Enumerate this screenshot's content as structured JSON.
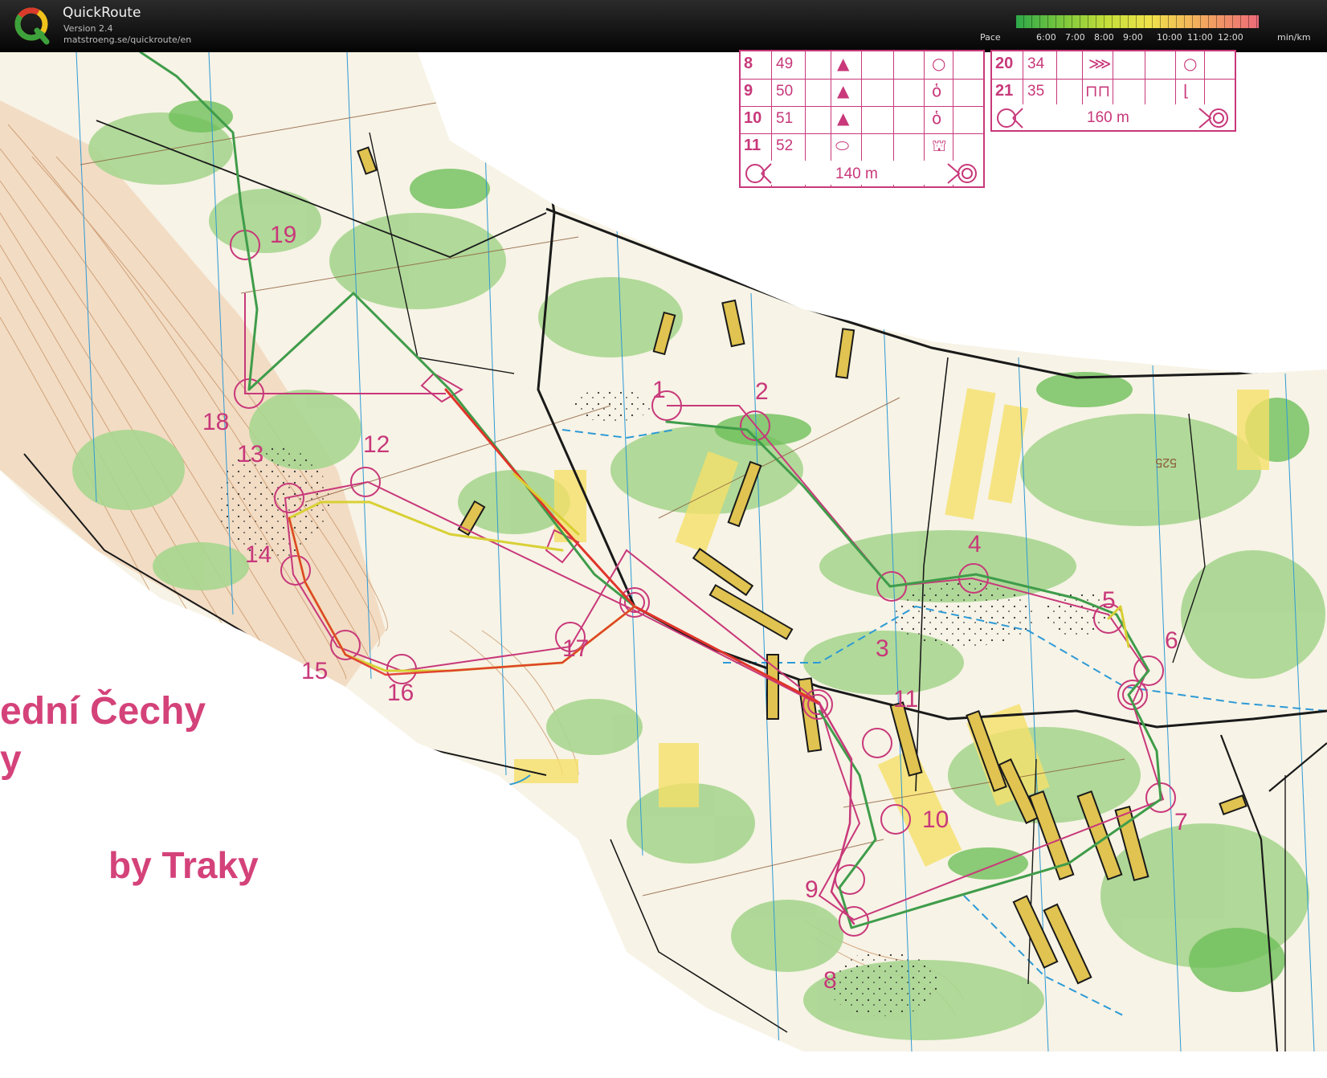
{
  "app": {
    "title": "QuickRoute",
    "version": "Version 2.4",
    "url": "matstroeng.se/quickroute/en"
  },
  "pace": {
    "label": "Pace",
    "ticks": [
      "6:00",
      "7:00",
      "8:00",
      "9:00",
      "10:00",
      "11:00",
      "12:00"
    ],
    "unit": "min/km"
  },
  "colors": {
    "course": "#c8387a",
    "route_red": "#e0342a",
    "route_green": "#3f9c4a",
    "route_yellow": "#d8d034",
    "forest_green": "#9fd28a",
    "open_yellow": "#f5e06a",
    "water_blue": "#2d9ad6"
  },
  "control_table_left": {
    "rows": [
      {
        "num": "8",
        "code": "49",
        "feature": "▲",
        "appearance": "○"
      },
      {
        "num": "9",
        "code": "50",
        "feature": "▲",
        "appearance": "ὁ"
      },
      {
        "num": "10",
        "code": "51",
        "feature": "▲",
        "appearance": "ὁ"
      },
      {
        "num": "11",
        "code": "52",
        "feature": "⬭",
        "appearance": "⛫"
      }
    ],
    "finish_distance": "140 m"
  },
  "control_table_right": {
    "rows": [
      {
        "num": "20",
        "code": "34",
        "feature": "⋙",
        "appearance": "○"
      },
      {
        "num": "21",
        "code": "35",
        "feature": "⊓⊓",
        "appearance": "⌊"
      }
    ],
    "finish_distance": "160 m"
  },
  "controls": [
    {
      "label": "1"
    },
    {
      "label": "2"
    },
    {
      "label": "3"
    },
    {
      "label": "4"
    },
    {
      "label": "5"
    },
    {
      "label": "6"
    },
    {
      "label": "7"
    },
    {
      "label": "8"
    },
    {
      "label": "9"
    },
    {
      "label": "10"
    },
    {
      "label": "11"
    },
    {
      "label": "12"
    },
    {
      "label": "13"
    },
    {
      "label": "14"
    },
    {
      "label": "15"
    },
    {
      "label": "16"
    },
    {
      "label": "17"
    },
    {
      "label": "18"
    },
    {
      "label": "19"
    }
  ],
  "map_texts": {
    "region_line1": "ední Čechy",
    "region_line2": "y",
    "author": "by Traky",
    "contour_label": "525"
  }
}
